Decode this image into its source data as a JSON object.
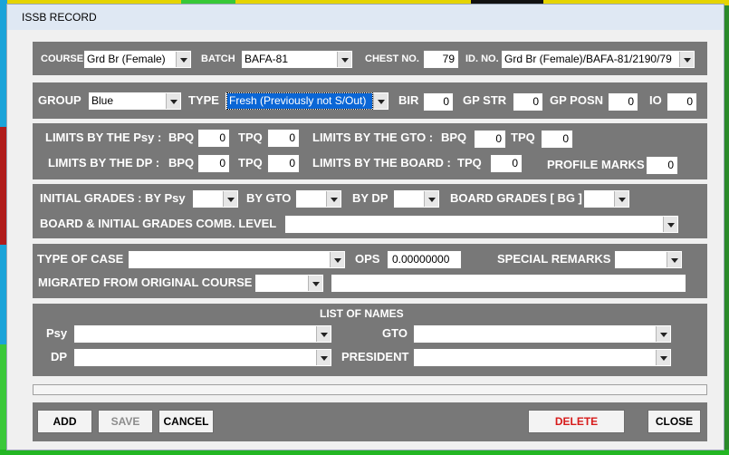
{
  "window": {
    "title": "ISSB RECORD"
  },
  "course_row": {
    "course_label": "COURSE",
    "course_value": "Grd Br (Female)",
    "batch_label": "BATCH",
    "batch_value": "BAFA-81",
    "chest_label": "CHEST NO.",
    "chest_value": "79",
    "id_label": "ID. NO.",
    "id_value": "Grd Br (Female)/BAFA-81/2190/79"
  },
  "group_row": {
    "group_label": "GROUP",
    "group_value": "Blue",
    "type_label": "TYPE",
    "type_value": "Fresh (Previously not S/Out)",
    "bir_label": "BIR",
    "bir_value": "0",
    "gpstr_label": "GP STR",
    "gpstr_value": "0",
    "gpposn_label": "GP POSN",
    "gpposn_value": "0",
    "io_label": "IO",
    "io_value": "0"
  },
  "limits": {
    "psy_label": "LIMITS BY THE Psy :",
    "psy_bpq_label": "BPQ",
    "psy_bpq": "0",
    "psy_tpq_label": "TPQ",
    "psy_tpq": "0",
    "gto_label": "LIMITS BY THE GTO :",
    "gto_bpq_label": "BPQ",
    "gto_bpq": "0",
    "gto_tpq_label": "TPQ",
    "gto_tpq": "0",
    "dp_label": "LIMITS BY THE DP :",
    "dp_bpq_label": "BPQ",
    "dp_bpq": "0",
    "dp_tpq_label": "TPQ",
    "dp_tpq": "0",
    "board_label": "LIMITS BY THE BOARD :",
    "board_tpq_label": "TPQ",
    "board_tpq": "0",
    "profile_label": "PROFILE MARKS",
    "profile_value": "0"
  },
  "grades": {
    "initial_label": "INITIAL GRADES : BY Psy",
    "by_gto_label": "BY GTO",
    "by_dp_label": "BY DP",
    "board_label": "BOARD GRADES [ BG ]",
    "comb_label": "BOARD & INITIAL GRADES COMB. LEVEL"
  },
  "case": {
    "type_label": "TYPE OF CASE",
    "ops_label": "OPS",
    "ops_value": "0.00000000",
    "remarks_label": "SPECIAL REMARKS",
    "migrated_label": "MIGRATED FROM ORIGINAL COURSE"
  },
  "names": {
    "title": "LIST OF NAMES",
    "psy_label": "Psy",
    "gto_label": "GTO",
    "dp_label": "DP",
    "president_label": "PRESIDENT"
  },
  "buttons": {
    "add": "ADD",
    "save": "SAVE",
    "cancel": "CANCEL",
    "delete": "DELETE",
    "close": "CLOSE"
  },
  "colors": {
    "panel": "#787878",
    "selection": "#0a66d6",
    "delete_text": "#d71b1b"
  }
}
